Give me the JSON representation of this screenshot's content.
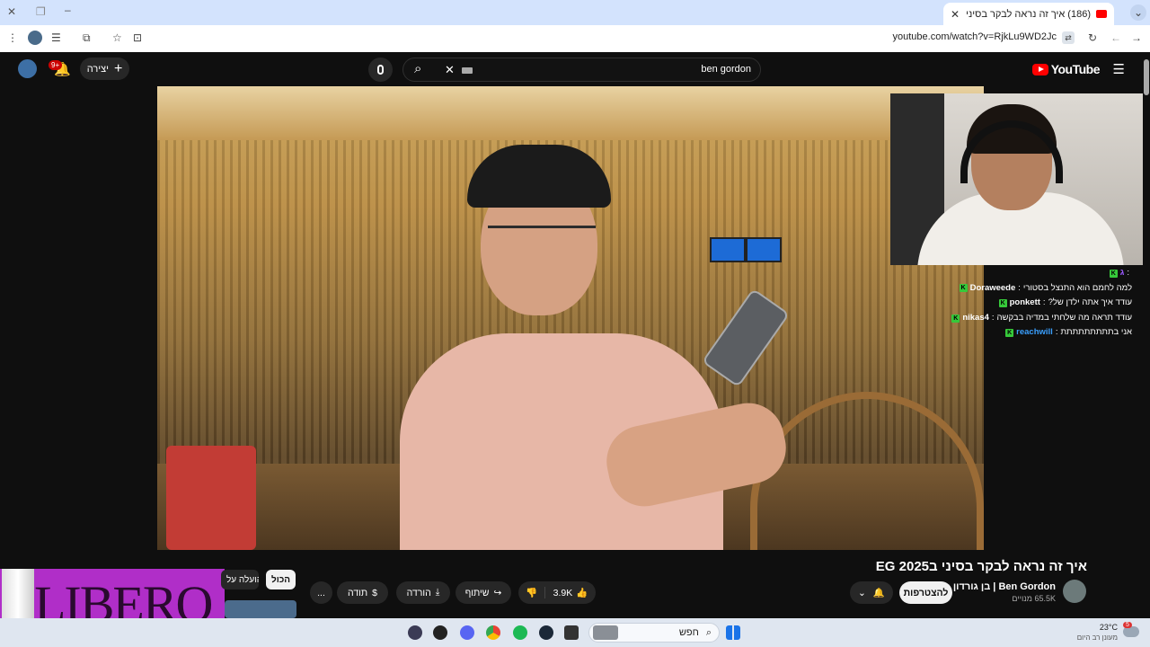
{
  "browser": {
    "tab_title": "(186) איך זה נראה לבקר בסיני ב...",
    "url": "youtube.com/watch?v=RjkLu9WD2Jc"
  },
  "youtube": {
    "search_query": "ben gordon",
    "create_label": "יצירה",
    "notif_count": "9+",
    "logo_text": "YouTube"
  },
  "chat": [
    {
      "user": "ג",
      "text": "",
      "badge": "K",
      "name_color": "#9b59ff"
    },
    {
      "user": "Doraweede",
      "text": "למה לחמם הוא התנצל בסטורי",
      "badge": "K",
      "name_color": "#ffffff"
    },
    {
      "user": "ponkett",
      "text": "עודד איך אתה ילדן של?",
      "badge": "K",
      "name_color": "#ffffff"
    },
    {
      "user": "nikas4",
      "text": "עודד תראה מה שלחתי במדיה בבקשה",
      "badge": "K",
      "name_color": "#ffffff"
    },
    {
      "user": "reachwill",
      "text": "אני בתתתתתתתתת",
      "badge": "K",
      "name_color": "#3aa0ff"
    }
  ],
  "video": {
    "title": "איך זה נראה לבקר בסיני ב2025 EG",
    "channel_name": "Ben Gordon | בן גורדון",
    "subscribers": "65.5K מנויים",
    "subscribe_label": "להצטרפות",
    "likes": "3.9K",
    "share_label": "שיתוף",
    "download_label": "הורדה",
    "thanks_label": "תודה",
    "more_label": "..."
  },
  "sidebar": {
    "chips": [
      "הכול",
      "הועלה על"
    ]
  },
  "ad": {
    "brand": "LIBERO"
  },
  "taskbar": {
    "search_label": "חפש",
    "weather_temp": "23°C",
    "weather_desc": "מעונן רב היום",
    "weather_badge": "5"
  },
  "colors": {
    "yt_red": "#ff0000",
    "accent_green": "#36c93a",
    "ad_purple": "#b02ec8"
  }
}
